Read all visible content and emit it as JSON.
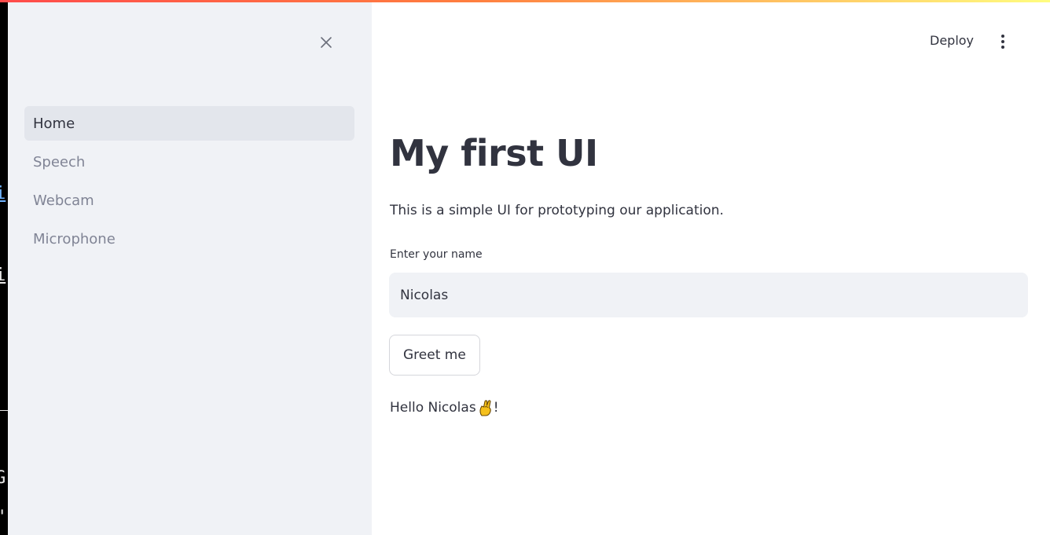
{
  "sidebar": {
    "items": [
      {
        "label": "Home",
        "active": true
      },
      {
        "label": "Speech",
        "active": false
      },
      {
        "label": "Webcam",
        "active": false
      },
      {
        "label": "Microphone",
        "active": false
      }
    ],
    "close_icon": "close-icon"
  },
  "header": {
    "deploy_label": "Deploy",
    "menu_icon": "vertical-dots-icon"
  },
  "main": {
    "title": "My first UI",
    "description": "This is a simple UI for prototyping our application.",
    "name_label": "Enter your name",
    "name_value": "Nicolas",
    "greet_button": "Greet me",
    "greeting_prefix": "Hello Nicolas",
    "greeting_emoji": "crossed-fingers-emoji",
    "greeting_suffix": "!"
  },
  "background_terminal": {
    "fragments": [
      "i",
      "i",
      "G",
      "\""
    ]
  },
  "colors": {
    "sidebar_bg": "#f0f2f6",
    "active_item_bg": "#e3e6ec",
    "text": "#31333f",
    "muted_text": "#808495",
    "accent_gradient_start": "#ff4b4b",
    "accent_gradient_end": "#fffd80"
  }
}
